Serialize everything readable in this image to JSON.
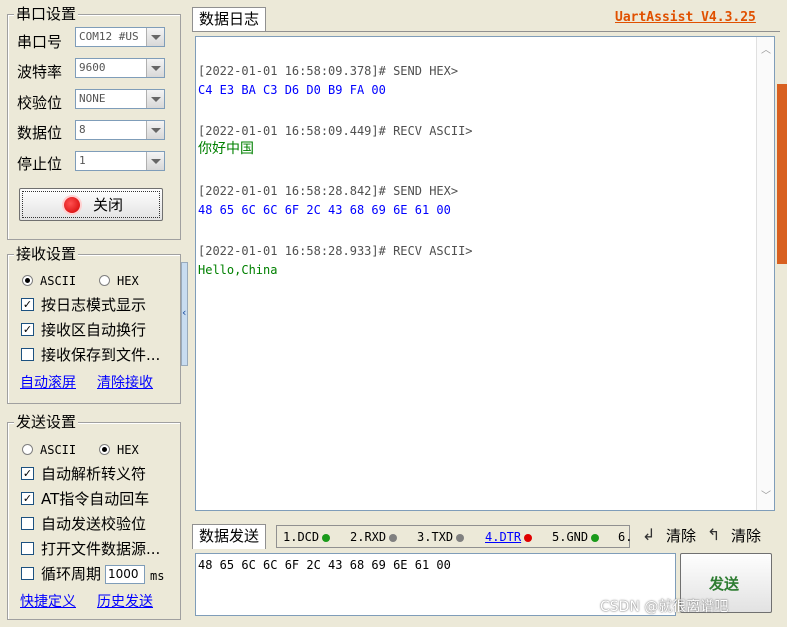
{
  "serial": {
    "title": "串口设置",
    "port_label": "串口号",
    "port_value": "COM12 #US",
    "baud_label": "波特率",
    "baud_value": "9600",
    "parity_label": "校验位",
    "parity_value": "NONE",
    "data_label": "数据位",
    "data_value": "8",
    "stop_label": "停止位",
    "stop_value": "1",
    "close_button": "关闭"
  },
  "receive": {
    "title": "接收设置",
    "ascii": "ASCII",
    "hex": "HEX",
    "log_mode": "按日志模式显示",
    "auto_wrap": "接收区自动换行",
    "save_file": "接收保存到文件...",
    "auto_scroll": "自动滚屏",
    "clear_recv": "清除接收"
  },
  "send": {
    "title": "发送设置",
    "ascii": "ASCII",
    "hex": "HEX",
    "parse_escape": "自动解析转义符",
    "at_return": "AT指令自动回车",
    "auto_checksum": "自动发送校验位",
    "open_file": "打开文件数据源...",
    "cycle": "循环周期",
    "cycle_value": "1000",
    "cycle_unit": "ms",
    "shortcut": "快捷定义",
    "history": "历史发送"
  },
  "log": {
    "tab": "数据日志",
    "app_title": "UartAssist V4.3.25",
    "entries": [
      {
        "header": "[2022-01-01 16:58:09.378]# SEND HEX>",
        "body": "C4 E3 BA C3 D6 D0 B9 FA 00",
        "type": "send"
      },
      {
        "header": "[2022-01-01 16:58:09.449]# RECV ASCII>",
        "body": "你好中国",
        "type": "recv"
      },
      {
        "header": "[2022-01-01 16:58:28.842]# SEND HEX>",
        "body": "48 65 6C 6C 6F 2C 43 68 69 6E 61 00",
        "type": "send"
      },
      {
        "header": "[2022-01-01 16:58:28.933]# RECV ASCII>",
        "body": "Hello,China",
        "type": "recv"
      }
    ]
  },
  "sendarea": {
    "tab": "数据发送",
    "text": "48 65 6C 6C 6F 2C 43 68 69 6E 61 00",
    "send_button": "发送",
    "clear1": "清除",
    "clear2": "清除",
    "signals": [
      {
        "label": "1.DCD",
        "color": "#1a9a1a"
      },
      {
        "label": "2.RXD",
        "color": "#808080"
      },
      {
        "label": "3.TXD",
        "color": "#808080"
      },
      {
        "label": "4.DTR",
        "color": "#e00000"
      },
      {
        "label": "5.GND",
        "color": "#1a9a1a"
      },
      {
        "label": "6.",
        "color": ""
      }
    ]
  },
  "watermark": "CSDN @就很离谱吧",
  "colors": {
    "send": "#0000ff",
    "recv": "#008000",
    "header": "#505050",
    "title": "#e05000"
  }
}
